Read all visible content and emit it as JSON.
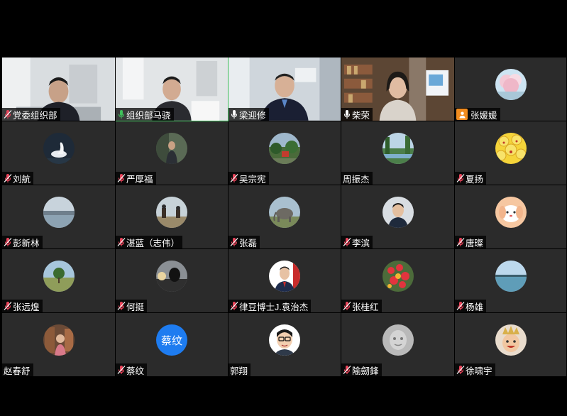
{
  "participants": [
    {
      "name": "党委组织部",
      "mic": "muted",
      "view": "video"
    },
    {
      "name": "组织部马骁",
      "mic": "active",
      "view": "video",
      "speaking": true
    },
    {
      "name": "梁迎修",
      "mic": "on",
      "view": "video"
    },
    {
      "name": "柴荣",
      "mic": "on",
      "view": "video"
    },
    {
      "name": "张媛媛",
      "mic": "none",
      "view": "avatar",
      "badge": "person-icon"
    },
    {
      "name": "刘航",
      "mic": "muted",
      "view": "avatar"
    },
    {
      "name": "严厚福",
      "mic": "muted",
      "view": "avatar"
    },
    {
      "name": "吴宗宪",
      "mic": "muted",
      "view": "avatar"
    },
    {
      "name": "周振杰",
      "mic": "none",
      "view": "avatar"
    },
    {
      "name": "夏扬",
      "mic": "muted",
      "view": "avatar"
    },
    {
      "name": "彭新林",
      "mic": "muted",
      "view": "avatar"
    },
    {
      "name": "湛蓝（志伟）",
      "mic": "muted",
      "view": "avatar"
    },
    {
      "name": "张磊",
      "mic": "muted",
      "view": "avatar"
    },
    {
      "name": "李滨",
      "mic": "muted",
      "view": "avatar"
    },
    {
      "name": "唐璨",
      "mic": "muted",
      "view": "avatar"
    },
    {
      "name": "张远煌",
      "mic": "muted",
      "view": "avatar"
    },
    {
      "name": "何挺",
      "mic": "muted",
      "view": "avatar"
    },
    {
      "name": "律豆博士J.袁治杰",
      "mic": "muted",
      "view": "avatar"
    },
    {
      "name": "张桂红",
      "mic": "muted",
      "view": "avatar"
    },
    {
      "name": "杨雄",
      "mic": "muted",
      "view": "avatar"
    },
    {
      "name": "赵春舒",
      "mic": "none",
      "view": "avatar"
    },
    {
      "name": "蔡纹",
      "mic": "muted",
      "view": "avatar",
      "initials": "蔡纹",
      "initials_color": "#1e7cf0"
    },
    {
      "name": "郭翔",
      "mic": "none",
      "view": "avatar"
    },
    {
      "name": "隃劒鋒",
      "mic": "muted",
      "view": "avatar"
    },
    {
      "name": "徐啸宇",
      "mic": "muted",
      "view": "avatar"
    }
  ],
  "colors": {
    "tile_bg": "#2b2b2b",
    "muted_mic": "#e8445a",
    "active_mic": "#3fbf5a",
    "speaking_border": "#3fbf5a",
    "badge": "#f28c1e"
  }
}
